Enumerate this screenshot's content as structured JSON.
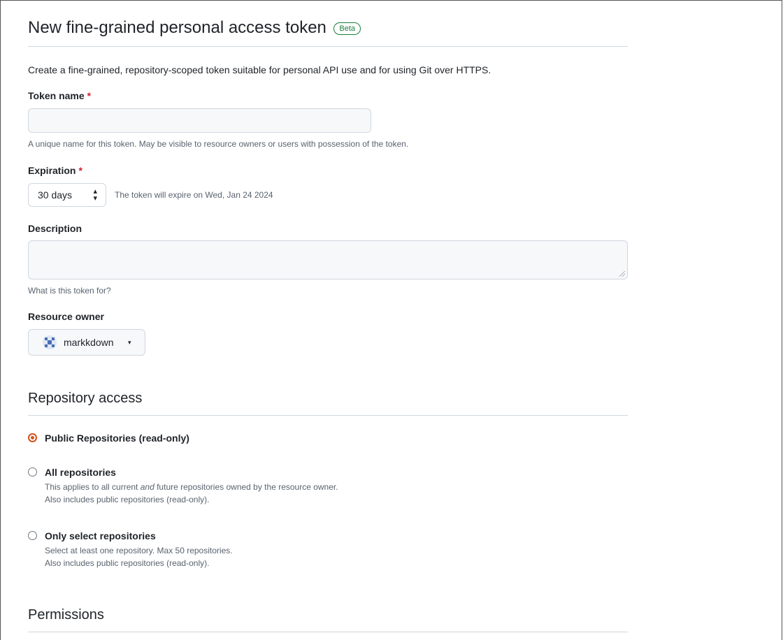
{
  "page": {
    "title": "New fine-grained personal access token",
    "badge": "Beta",
    "intro": "Create a fine-grained, repository-scoped token suitable for personal API use and for using Git over HTTPS."
  },
  "token_name": {
    "label": "Token name",
    "required_mark": "*",
    "value": "",
    "note": "A unique name for this token. May be visible to resource owners or users with possession of the token."
  },
  "expiration": {
    "label": "Expiration",
    "required_mark": "*",
    "selected": "30 days",
    "note": "The token will expire on Wed, Jan 24 2024"
  },
  "description": {
    "label": "Description",
    "value": "",
    "note": "What is this token for?"
  },
  "resource_owner": {
    "label": "Resource owner",
    "selected": "markkdown",
    "caret": "▾"
  },
  "repository_access": {
    "heading": "Repository access",
    "options": [
      {
        "label": "Public Repositories (read-only)",
        "checked": true,
        "desc1": "",
        "desc2": ""
      },
      {
        "label": "All repositories",
        "checked": false,
        "desc1_pre": "This applies to all current ",
        "desc1_em": "and",
        "desc1_post": " future repositories owned by the resource owner.",
        "desc2": "Also includes public repositories (read-only)."
      },
      {
        "label": "Only select repositories",
        "checked": false,
        "desc1": "Select at least one repository. Max 50 repositories.",
        "desc2": "Also includes public repositories (read-only)."
      }
    ]
  },
  "permissions": {
    "heading": "Permissions"
  },
  "colors": {
    "accent_radio": "#d0521e",
    "required": "#cf222e",
    "beta": "#1a7f37"
  }
}
